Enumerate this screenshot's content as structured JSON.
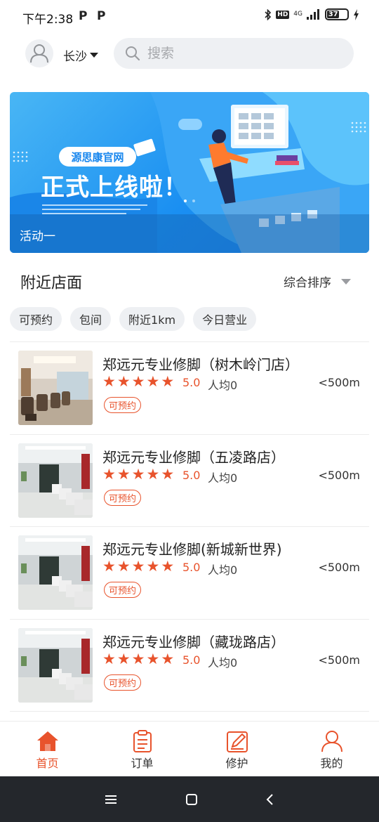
{
  "status_bar": {
    "time": "下午2:38",
    "app_icons": [
      "P",
      "P"
    ],
    "network": "4G",
    "hd": "HD",
    "battery": "37"
  },
  "header": {
    "city": "长沙",
    "search_placeholder": "搜索"
  },
  "banner": {
    "chip_text": "源思康官网",
    "headline": "正式上线啦！",
    "caption": "活动一"
  },
  "nearby": {
    "title": "附近店面",
    "sort_label": "综合排序",
    "filters": [
      "可预约",
      "包间",
      "附近1km",
      "今日营业"
    ]
  },
  "shops": [
    {
      "name": "郑远元专业修脚（树木岭门店）",
      "rating": "5.0",
      "stars": 5,
      "avg": "人均0",
      "distance": "<500m",
      "tag": "可预约"
    },
    {
      "name": "郑远元专业修脚（五凌路店）",
      "rating": "5.0",
      "stars": 5,
      "avg": "人均0",
      "distance": "<500m",
      "tag": "可预约"
    },
    {
      "name": "郑远元专业修脚(新城新世界)",
      "rating": "5.0",
      "stars": 5,
      "avg": "人均0",
      "distance": "<500m",
      "tag": "可预约"
    },
    {
      "name": "郑远元专业修脚（藏珑路店）",
      "rating": "5.0",
      "stars": 5,
      "avg": "人均0",
      "distance": "<500m",
      "tag": "可预约"
    }
  ],
  "tabbar": {
    "tabs": [
      {
        "label": "首页",
        "icon": "home-icon",
        "active": true
      },
      {
        "label": "订单",
        "icon": "clipboard-icon",
        "active": false
      },
      {
        "label": "修护",
        "icon": "edit-icon",
        "active": false
      },
      {
        "label": "我的",
        "icon": "person-icon",
        "active": false
      }
    ]
  },
  "colors": {
    "accent": "#e8532c",
    "banner_blue": "#1a8ff2",
    "chip_bg": "#eef0f3",
    "system_nav": "#24272c"
  }
}
